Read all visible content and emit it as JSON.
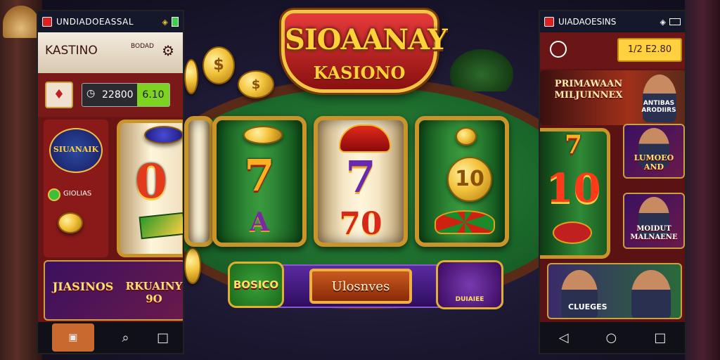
{
  "center": {
    "logo_line1": "SIOAANAY",
    "logo_line2": "KASIONO",
    "bottom_button": "Ulosnves",
    "left_badge": "BOSICO",
    "right_badge": "DUIAIEE"
  },
  "reels": [
    {
      "symbols": [
        "0"
      ]
    },
    {
      "symbols": [
        "7",
        "A"
      ]
    },
    {
      "symbols": [
        "7",
        "70"
      ]
    },
    {
      "symbols": [
        "10"
      ]
    }
  ],
  "left_phone": {
    "status_title": "UNDIADOEASSAL",
    "header_title": "KASTINO",
    "header_sub": "BODAD",
    "balance": "22800",
    "balance_action": "6.10",
    "promo_label": "SIUANAIK",
    "coins_label": "GIOLIAS",
    "banner_left": "JIASINOS",
    "banner_right": "RKUAINY 9O",
    "nav": [
      "search-icon",
      "square-icon"
    ]
  },
  "right_phone": {
    "status_title": "UIADAOESINS",
    "header_amount": "1/2 E2.80",
    "feature_title": "PRIMAWAAN MILJUINNEX",
    "feature_side": "ANTIBAS ARODIIRS",
    "slot_value": "10",
    "slot_seven": "7",
    "card1": "LUMOEO AND",
    "card2": "MOIDUT MALNAENE",
    "bottom_card": "CLUEGES",
    "nav": [
      "back-icon",
      "home-icon",
      "recent-icon"
    ]
  },
  "colors": {
    "phone_bg": "#6a1414",
    "gold": "#f4c542",
    "table_green": "#2f8a3e",
    "balance_green": "#7ed321"
  }
}
